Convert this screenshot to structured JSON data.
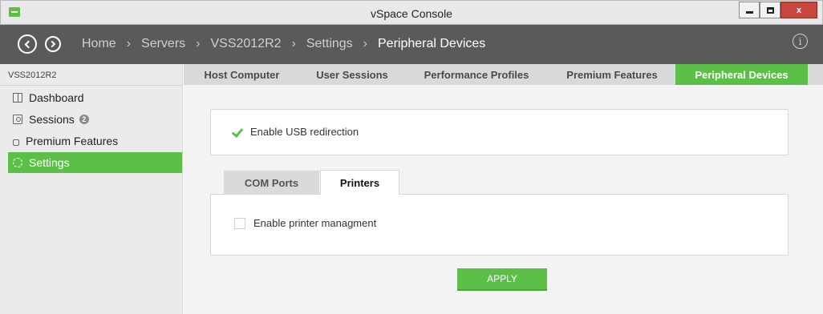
{
  "window": {
    "title": "vSpace Console",
    "icon": "vspace-app-icon",
    "controls": [
      "minimize-icon",
      "maximize-icon",
      "close-icon"
    ],
    "close_label": "x"
  },
  "header": {
    "breadcrumb": [
      "Home",
      "Servers",
      "VSS2012R2",
      "Settings",
      "Peripheral Devices"
    ],
    "separator": "›",
    "info_icon": "i"
  },
  "sidebar": {
    "server_name": "VSS2012R2",
    "items": [
      {
        "label": "Dashboard",
        "icon": "dashboard-icon",
        "active": false
      },
      {
        "label": "Sessions",
        "icon": "sessions-icon",
        "badge": "2",
        "active": false
      },
      {
        "label": "Premium Features",
        "icon": "premium-features-icon",
        "active": false
      },
      {
        "label": "Settings",
        "icon": "settings-icon",
        "active": true
      }
    ]
  },
  "tabs": [
    {
      "label": "Host Computer",
      "active": false
    },
    {
      "label": "User Sessions",
      "active": false
    },
    {
      "label": "Performance Profiles",
      "active": false
    },
    {
      "label": "Premium Features",
      "active": false
    },
    {
      "label": "Peripheral Devices",
      "active": true
    }
  ],
  "usb": {
    "label": "Enable USB redirection",
    "checked": true
  },
  "subtabs": [
    {
      "label": "COM Ports",
      "active": false
    },
    {
      "label": "Printers",
      "active": true
    }
  ],
  "printers": {
    "label": "Enable printer managment",
    "checked": false
  },
  "apply_label": "APPLY",
  "colors": {
    "accent": "#5cbf47",
    "header_bg": "#5a5a5a",
    "close_button": "#c7463e"
  }
}
